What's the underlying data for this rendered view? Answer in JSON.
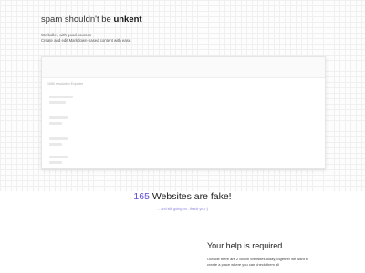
{
  "hero": {
    "title_prefix": "spam shouldn't be ",
    "title_brand": "unkent",
    "subtitle_line1": "We bullet, with good sources",
    "subtitle_line2": "Create and edit Markdown-based content with ease."
  },
  "panel": {
    "label": "1080 resolution Exporter"
  },
  "stats": {
    "count": "165",
    "title_suffix": " Websites are fake!",
    "subtitle": "... and still going on - thank you :)"
  },
  "help": {
    "title": "Your help is required.",
    "body_line1": "Outside there are 2 Billion Websites today, together we want to",
    "body_line2": "create a place where you can check them all"
  }
}
